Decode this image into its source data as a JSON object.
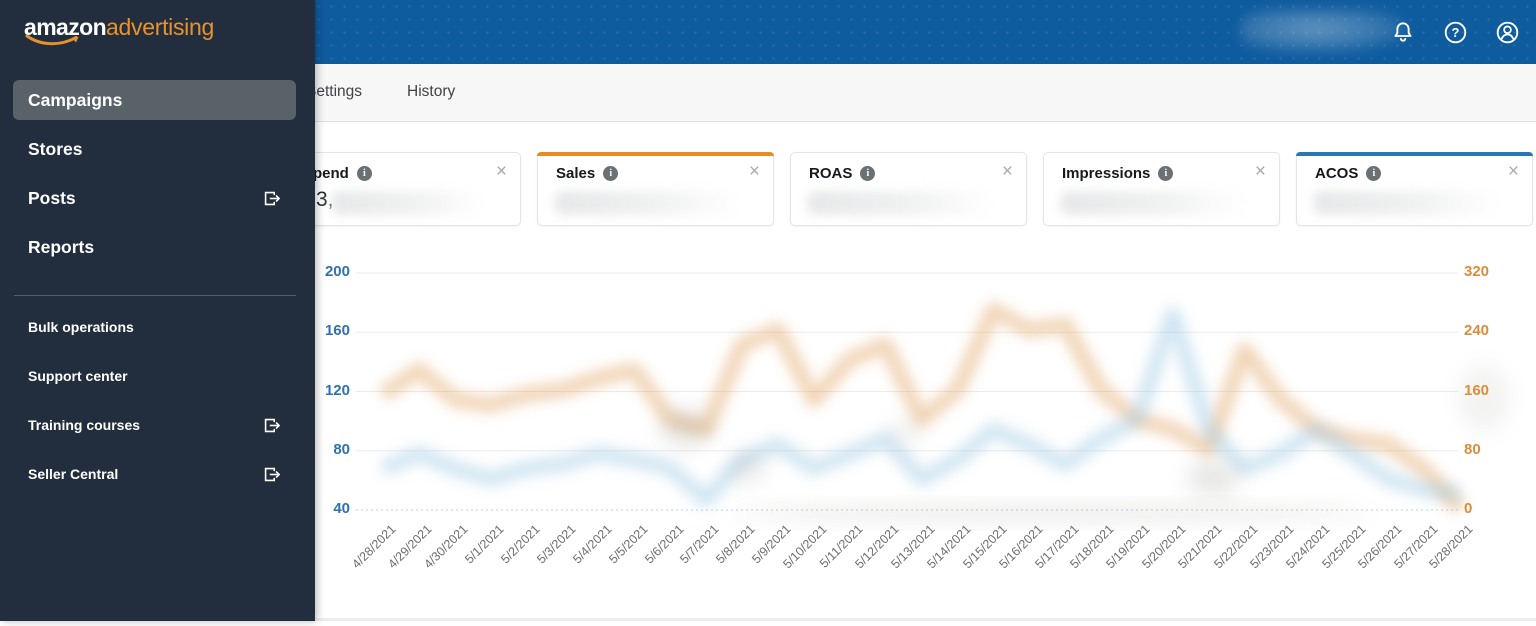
{
  "brand": {
    "logo_primary": "amazon",
    "logo_secondary": "advertising"
  },
  "header": {
    "icons": [
      {
        "name": "notifications-bell"
      },
      {
        "name": "help"
      },
      {
        "name": "account"
      }
    ],
    "account_info_redacted": true
  },
  "tabs": {
    "items": [
      {
        "label": "Settings"
      },
      {
        "label": "History"
      }
    ]
  },
  "sidebar": {
    "primary": [
      {
        "label": "Campaigns",
        "active": true
      },
      {
        "label": "Stores"
      },
      {
        "label": "Posts",
        "external": true
      },
      {
        "label": "Reports"
      }
    ],
    "secondary": [
      {
        "label": "Bulk operations"
      },
      {
        "label": "Support center"
      },
      {
        "label": "Training courses",
        "external": true
      },
      {
        "label": "Seller Central",
        "external": true
      }
    ]
  },
  "metric_cards": {
    "info_glyph": "i",
    "close_glyph": "×",
    "cards": [
      {
        "label": "Spend",
        "accent": "",
        "value_fragment": "3,",
        "redacted": true
      },
      {
        "label": "Sales",
        "accent": "#e78b24",
        "redacted": true
      },
      {
        "label": "ROAS",
        "accent": "",
        "redacted": true
      },
      {
        "label": "Impressions",
        "accent": "",
        "redacted": true
      },
      {
        "label": "ACOS",
        "accent": "#2a76b2",
        "redacted": true
      }
    ]
  },
  "chart_data": {
    "type": "line",
    "title": "",
    "grid": true,
    "legend": false,
    "blurred": true,
    "note": "Series content is privacy-blurred in the source screenshot; values below are visual approximations of the blurred curves.",
    "x": [
      "4/28/2021",
      "4/29/2021",
      "4/30/2021",
      "5/1/2021",
      "5/2/2021",
      "5/3/2021",
      "5/4/2021",
      "5/5/2021",
      "5/6/2021",
      "5/7/2021",
      "5/8/2021",
      "5/9/2021",
      "5/10/2021",
      "5/11/2021",
      "5/12/2021",
      "5/13/2021",
      "5/14/2021",
      "5/15/2021",
      "5/16/2021",
      "5/17/2021",
      "5/18/2021",
      "5/19/2021",
      "5/20/2021",
      "5/21/2021",
      "5/22/2021",
      "5/23/2021",
      "5/24/2021",
      "5/25/2021",
      "5/26/2021",
      "5/27/2021",
      "5/28/2021"
    ],
    "left_axis": {
      "color": "#2d72b0",
      "ticks": [
        200,
        160,
        120,
        80,
        40
      ],
      "min": 40,
      "max": 200
    },
    "right_axis": {
      "color": "#dd8c3a",
      "ticks": [
        320,
        240,
        160,
        80,
        0
      ],
      "min": 0,
      "max": 320
    },
    "series": [
      {
        "name": "Sales",
        "axis": "right",
        "color": "#e2a566",
        "values": [
          156,
          189,
          149,
          142,
          156,
          162,
          178,
          189,
          122,
          109,
          223,
          243,
          149,
          203,
          223,
          122,
          162,
          270,
          243,
          250,
          162,
          122,
          109,
          82,
          216,
          149,
          109,
          95,
          89,
          55,
          2
        ]
      },
      {
        "name": "ACOS",
        "axis": "left",
        "color": "#9fc9e4",
        "values": [
          68,
          78,
          68,
          61,
          68,
          71,
          78,
          74,
          68,
          47,
          74,
          84,
          68,
          78,
          88,
          61,
          74,
          94,
          84,
          71,
          88,
          101,
          172,
          94,
          68,
          78,
          94,
          78,
          61,
          54,
          51
        ]
      }
    ]
  }
}
